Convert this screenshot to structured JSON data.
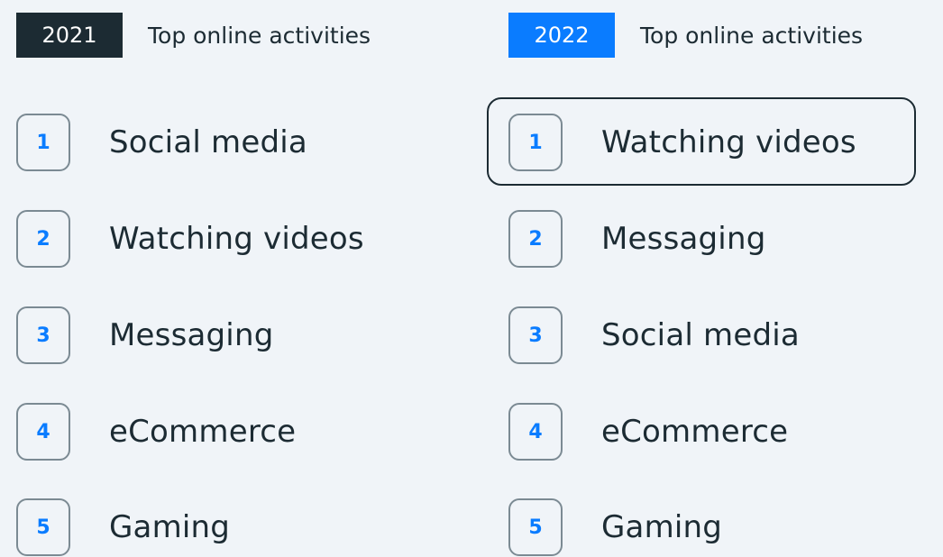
{
  "left": {
    "year": "2021",
    "title": "Top online activities",
    "items": [
      {
        "rank": "1",
        "label": "Social media"
      },
      {
        "rank": "2",
        "label": "Watching videos"
      },
      {
        "rank": "3",
        "label": "Messaging"
      },
      {
        "rank": "4",
        "label": "eCommerce"
      },
      {
        "rank": "5",
        "label": "Gaming"
      }
    ]
  },
  "right": {
    "year": "2022",
    "title": "Top online activities",
    "items": [
      {
        "rank": "1",
        "label": "Watching videos"
      },
      {
        "rank": "2",
        "label": "Messaging"
      },
      {
        "rank": "3",
        "label": "Social media"
      },
      {
        "rank": "4",
        "label": "eCommerce"
      },
      {
        "rank": "5",
        "label": "Gaming"
      }
    ]
  },
  "colors": {
    "background": "#f0f4f8",
    "text": "#1c2b33",
    "accent_blue": "#0a7cff",
    "badge_dark": "#1c2b33",
    "rank_border": "#7b8a93"
  }
}
